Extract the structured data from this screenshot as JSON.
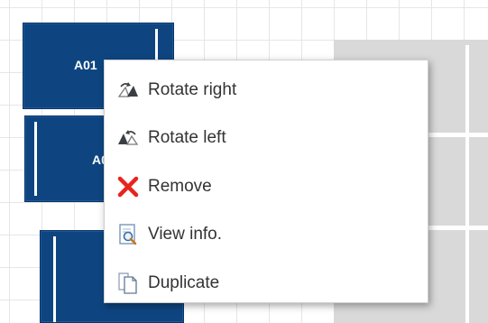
{
  "canvas": {
    "blocks": [
      {
        "label": "A01"
      },
      {
        "label": "A0"
      },
      {
        "label": ""
      }
    ]
  },
  "context_menu": {
    "items": [
      {
        "label": "Rotate right",
        "icon": "rotate-right-icon"
      },
      {
        "label": "Rotate left",
        "icon": "rotate-left-icon"
      },
      {
        "label": "Remove",
        "icon": "remove-icon"
      },
      {
        "label": "View info.",
        "icon": "view-info-icon"
      },
      {
        "label": "Duplicate",
        "icon": "duplicate-icon"
      }
    ]
  },
  "colors": {
    "block_fill": "#0e4580",
    "placeholder_fill": "#d9d9d9",
    "remove_icon": "#e8241c"
  }
}
